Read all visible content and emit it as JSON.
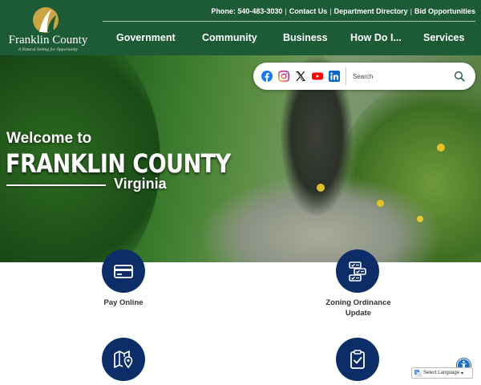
{
  "header": {
    "logo": {
      "title": "Franklin County",
      "tagline": "A Natural Setting for Opportunity"
    },
    "utility_links": [
      "Phone: 540-483-3030",
      "Contact Us",
      "Department Directory",
      "Bid Opportunities"
    ],
    "nav": [
      "Government",
      "Community",
      "Business",
      "How Do I...",
      "Services"
    ]
  },
  "hero": {
    "welcome": "Welcome to",
    "county": "FRANKLIN COUNTY",
    "state": "Virginia"
  },
  "toolbar": {
    "social_icons": [
      "facebook-icon",
      "instagram-icon",
      "x-icon",
      "youtube-icon",
      "linkedin-icon"
    ],
    "search": {
      "placeholder": "Search",
      "value": ""
    }
  },
  "quick_links": [
    {
      "label": "Pay Online",
      "icon": "credit-card-icon"
    },
    {
      "label": "Zoning Ordinance Update",
      "icon": "checklist-icon"
    },
    {
      "label": "",
      "icon": "map-pin-icon"
    },
    {
      "label": "",
      "icon": "clipboard-check-icon"
    }
  ],
  "widgets": {
    "translate_label": "Select Language",
    "accessibility_icon": "accessibility-icon"
  },
  "colors": {
    "header_green": "#1d5a36",
    "quick_link_navy": "#0c2d68",
    "logo_gold": "#c9a645",
    "accessibility_blue": "#1c6fc4"
  }
}
